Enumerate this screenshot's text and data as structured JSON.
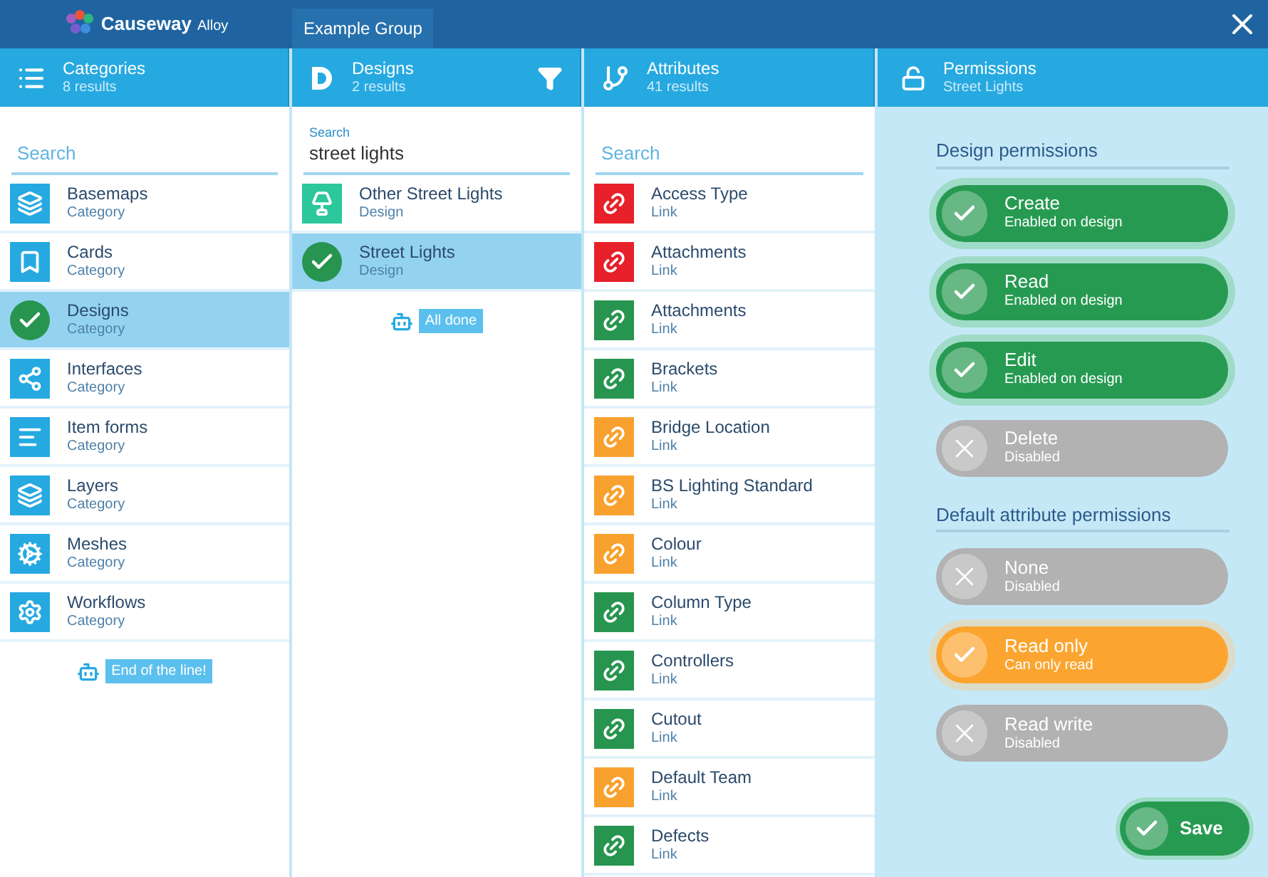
{
  "app": {
    "brand": "Causeway",
    "product": "Alloy",
    "group": "Example Group"
  },
  "columns": [
    {
      "title": "Categories",
      "subtitle": "8 results",
      "search": {
        "placeholder": "Search"
      },
      "items": [
        {
          "name": "Basemaps",
          "type": "Category",
          "selected": false
        },
        {
          "name": "Cards",
          "type": "Category",
          "selected": false
        },
        {
          "name": "Designs",
          "type": "Category",
          "selected": true
        },
        {
          "name": "Interfaces",
          "type": "Category",
          "selected": false
        },
        {
          "name": "Item forms",
          "type": "Category",
          "selected": false
        },
        {
          "name": "Layers",
          "type": "Category",
          "selected": false
        },
        {
          "name": "Meshes",
          "type": "Category",
          "selected": false
        },
        {
          "name": "Workflows",
          "type": "Category",
          "selected": false
        }
      ],
      "footer": "End of the line!"
    },
    {
      "title": "Designs",
      "subtitle": "2 results",
      "search": {
        "label": "Search",
        "value": "street lights"
      },
      "filter": true,
      "items": [
        {
          "name": "Other Street Lights",
          "type": "Design",
          "selected": false
        },
        {
          "name": "Street Lights",
          "type": "Design",
          "selected": true
        }
      ],
      "footer": "All done"
    },
    {
      "title": "Attributes",
      "subtitle": "41 results",
      "search": {
        "placeholder": "Search"
      },
      "items": [
        {
          "name": "Access Type",
          "type": "Link",
          "color": "#e8202a",
          "selected": false
        },
        {
          "name": "Attachments",
          "type": "Link",
          "color": "#e8202a",
          "selected": false
        },
        {
          "name": "Attachments",
          "type": "Link",
          "color": "#27954f",
          "selected": false
        },
        {
          "name": "Brackets",
          "type": "Link",
          "color": "#27954f",
          "selected": false
        },
        {
          "name": "Bridge Location",
          "type": "Link",
          "color": "#f9a12e",
          "selected": false
        },
        {
          "name": "BS Lighting Standard",
          "type": "Link",
          "color": "#f9a12e",
          "selected": false
        },
        {
          "name": "Colour",
          "type": "Link",
          "color": "#f9a12e",
          "selected": false
        },
        {
          "name": "Column Type",
          "type": "Link",
          "color": "#27954f",
          "selected": false
        },
        {
          "name": "Controllers",
          "type": "Link",
          "color": "#27954f",
          "selected": false
        },
        {
          "name": "Cutout",
          "type": "Link",
          "color": "#27954f",
          "selected": false
        },
        {
          "name": "Default Team",
          "type": "Link",
          "color": "#f9a12e",
          "selected": false
        },
        {
          "name": "Defects",
          "type": "Link",
          "color": "#27954f",
          "selected": false
        }
      ]
    }
  ],
  "permissions": {
    "title": "Permissions",
    "subtitle": "Street Lights",
    "sections": [
      {
        "heading": "Design permissions",
        "items": [
          {
            "name": "Create",
            "status": "Enabled on design",
            "on": true,
            "color": "#279a52"
          },
          {
            "name": "Read",
            "status": "Enabled on design",
            "on": true,
            "color": "#279a52"
          },
          {
            "name": "Edit",
            "status": "Enabled on design",
            "on": true,
            "color": "#279a52"
          },
          {
            "name": "Delete",
            "status": "Disabled",
            "on": false,
            "color": "#b2b2b2"
          }
        ]
      },
      {
        "heading": "Default attribute permissions",
        "items": [
          {
            "name": "None",
            "status": "Disabled",
            "on": false,
            "color": "#b2b2b2"
          },
          {
            "name": "Read only",
            "status": "Can only read",
            "on": true,
            "color": "#fba530"
          },
          {
            "name": "Read write",
            "status": "Disabled",
            "on": false,
            "color": "#b2b2b2"
          }
        ]
      }
    ],
    "save": "Save"
  }
}
